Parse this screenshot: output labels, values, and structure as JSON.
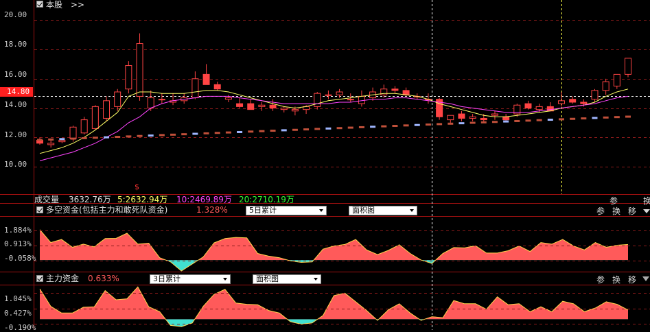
{
  "header": {
    "title": "本股",
    "expand": ">>"
  },
  "price_axis": {
    "labels": [
      "20.00",
      "18.00",
      "16.00",
      "14.80",
      "14.00",
      "12.00",
      "10.00"
    ],
    "current": "14.80"
  },
  "volume": {
    "label": "成交量",
    "total": "3632.76万",
    "ma5": "5:2632.94万",
    "ma10": "10:2469.89万",
    "ma20": "20:2710.19万"
  },
  "panel1": {
    "help": "?",
    "title": "多空资金(包括主力和敢死队资金)",
    "value": "1.328%",
    "period": "5日累计",
    "chart_type": "面积图",
    "levels": [
      "1.884%",
      "0.913%",
      "-0.058%"
    ],
    "tools": [
      "参",
      "换",
      "移"
    ]
  },
  "panel2": {
    "help": "?",
    "title": "主力资金",
    "value": "0.633%",
    "period": "3日累计",
    "chart_type": "面积图",
    "levels": [
      "1.045%",
      "0.427%",
      "-0.190%"
    ],
    "tools": [
      "参",
      "换",
      "移"
    ]
  },
  "right_tools": [
    "参",
    "换"
  ],
  "marker": "$",
  "colors": {
    "up": "#ff4444",
    "down": "#ff4444",
    "ma5": "#ffff66",
    "ma10": "#ff44ff",
    "ma20": "#33ff33",
    "area": "#ff5a5a",
    "area_neg": "#40e0d0",
    "grid": "#8b1a1a",
    "blue": "#9fb6ff"
  },
  "chart_data": [
    {
      "type": "candlestick",
      "title": "本股",
      "ylim": [
        8.5,
        21
      ],
      "candles": [
        [
          11.8,
          12.0,
          11.5,
          11.6
        ],
        [
          11.5,
          11.8,
          11.3,
          11.6
        ],
        [
          11.7,
          11.9,
          11.6,
          11.8
        ],
        [
          11.9,
          12.8,
          11.7,
          12.7
        ],
        [
          12.3,
          13.4,
          12.2,
          13.2
        ],
        [
          12.6,
          14.2,
          12.5,
          14.1
        ],
        [
          13.3,
          14.8,
          13.1,
          14.5
        ],
        [
          14.1,
          15.3,
          13.8,
          15.1
        ],
        [
          15.3,
          17.2,
          15.0,
          16.9
        ],
        [
          14.8,
          19.1,
          14.5,
          18.4
        ],
        [
          14.0,
          15.2,
          13.8,
          14.7
        ],
        [
          14.6,
          15.0,
          14.3,
          14.6
        ],
        [
          14.4,
          15.0,
          14.2,
          14.5
        ],
        [
          14.5,
          15.0,
          14.3,
          14.7
        ],
        [
          14.7,
          16.5,
          14.6,
          16.0
        ],
        [
          16.3,
          17.0,
          16.0,
          15.6
        ],
        [
          15.6,
          15.8,
          15.2,
          15.3
        ],
        [
          14.6,
          14.9,
          14.4,
          14.7
        ],
        [
          14.3,
          14.7,
          14.0,
          14.1
        ],
        [
          14.3,
          14.6,
          13.9,
          13.9
        ],
        [
          14.1,
          14.4,
          13.8,
          14.2
        ],
        [
          14.2,
          14.6,
          13.8,
          14.0
        ],
        [
          13.9,
          14.1,
          13.7,
          14.0
        ],
        [
          13.8,
          14.1,
          13.5,
          13.9
        ],
        [
          13.9,
          14.2,
          13.6,
          14.1
        ],
        [
          14.1,
          15.1,
          13.9,
          15.0
        ],
        [
          14.9,
          15.2,
          14.6,
          14.9
        ],
        [
          14.9,
          15.3,
          14.7,
          15.1
        ],
        [
          14.6,
          15.0,
          14.4,
          14.6
        ],
        [
          14.3,
          15.2,
          14.1,
          14.8
        ],
        [
          14.7,
          15.4,
          14.5,
          15.1
        ],
        [
          14.9,
          15.6,
          14.7,
          15.3
        ],
        [
          15.3,
          15.5,
          15.0,
          15.2
        ],
        [
          15.2,
          15.4,
          14.8,
          14.9
        ],
        [
          14.8,
          15.0,
          14.6,
          14.8
        ],
        [
          14.6,
          15.0,
          14.3,
          14.6
        ],
        [
          14.6,
          14.7,
          13.2,
          13.4
        ],
        [
          13.2,
          13.5,
          13.0,
          13.5
        ],
        [
          13.6,
          13.8,
          13.1,
          13.3
        ],
        [
          13.3,
          13.6,
          13.1,
          13.4
        ],
        [
          13.3,
          13.6,
          13.0,
          13.2
        ],
        [
          13.5,
          13.8,
          13.2,
          13.6
        ],
        [
          13.4,
          13.6,
          13.1,
          13.2
        ],
        [
          13.6,
          14.3,
          13.4,
          14.2
        ],
        [
          14.3,
          14.5,
          13.9,
          14.0
        ],
        [
          13.9,
          14.3,
          13.7,
          14.1
        ],
        [
          14.1,
          14.4,
          13.8,
          13.8
        ],
        [
          14.3,
          15.1,
          14.1,
          14.5
        ],
        [
          14.6,
          14.8,
          14.3,
          14.4
        ],
        [
          14.4,
          14.6,
          14.1,
          14.3
        ],
        [
          14.6,
          15.3,
          14.4,
          15.2
        ],
        [
          15.2,
          16.0,
          14.9,
          15.8
        ],
        [
          15.5,
          16.1,
          15.3,
          16.3
        ],
        [
          16.3,
          17.3,
          16.1,
          17.4
        ]
      ],
      "ma5": [
        10.9,
        11.1,
        11.3,
        11.6,
        12.0,
        12.5,
        13.1,
        13.7,
        14.8,
        15.1,
        15.1,
        15.0,
        15.0,
        15.0,
        15.1,
        15.2,
        15.2,
        15.1,
        14.9,
        14.7,
        14.5,
        14.3,
        14.1,
        14.0,
        14.1,
        14.3,
        14.5,
        14.6,
        14.7,
        14.8,
        14.9,
        15.0,
        15.0,
        14.9,
        14.8,
        14.6,
        14.3,
        14.1,
        13.9,
        13.7,
        13.5,
        13.4,
        13.4,
        13.5,
        13.6,
        13.7,
        13.8,
        14.0,
        14.1,
        14.2,
        14.4,
        14.8,
        15.1,
        15.3
      ],
      "ma10": [
        10.4,
        10.6,
        10.8,
        11.0,
        11.3,
        11.6,
        12.0,
        12.4,
        13.0,
        13.4,
        14.0,
        14.3,
        14.5,
        14.6,
        14.7,
        14.8,
        14.8,
        14.8,
        14.7,
        14.6,
        14.5,
        14.4,
        14.3,
        14.3,
        14.3,
        14.3,
        14.3,
        14.4,
        14.4,
        14.5,
        14.6,
        14.6,
        14.7,
        14.7,
        14.6,
        14.5,
        14.4,
        14.3,
        14.1,
        14.0,
        13.9,
        13.8,
        13.7,
        13.7,
        13.7,
        13.8,
        13.9,
        14.0,
        14.1,
        14.2,
        14.3,
        14.5,
        14.7,
        14.8
      ]
    },
    {
      "type": "area",
      "title": "多空资金(包括主力和敢死队资金)",
      "ylim": [
        -0.7,
        2.6
      ],
      "values": [
        1.95,
        1.12,
        1.32,
        0.82,
        1.02,
        0.85,
        1.38,
        1.39,
        1.72,
        1.02,
        1.08,
        0.15,
        -0.12,
        -0.7,
        -0.25,
        0.2,
        1.1,
        1.38,
        1.45,
        1.42,
        0.42,
        0.25,
        0.15,
        -0.05,
        -0.15,
        -0.12,
        0.7,
        0.9,
        1.0,
        1.32,
        0.65,
        0.35,
        0.62,
        0.98,
        0.42,
        0.0,
        -0.22,
        0.42,
        0.8,
        0.78,
        0.92,
        0.45,
        0.45,
        0.6,
        0.9,
        0.55,
        1.12,
        1.02,
        1.32,
        0.9,
        0.65,
        1.12,
        0.82,
        0.95,
        1.0
      ]
    },
    {
      "type": "area",
      "title": "主力资金",
      "ylim": [
        -0.35,
        1.25
      ],
      "values": [
        1.22,
        0.52,
        0.25,
        0.25,
        0.48,
        0.5,
        1.15,
        0.78,
        0.82,
        1.3,
        0.5,
        0.3,
        -0.25,
        -0.3,
        -0.15,
        0.52,
        1.0,
        1.2,
        0.65,
        0.6,
        0.58,
        0.35,
        0.25,
        -0.1,
        -0.2,
        -0.15,
        0.15,
        0.95,
        1.05,
        0.7,
        0.35,
        -0.05,
        0.38,
        0.62,
        0.25,
        -0.05,
        0.1,
        0.06,
        0.75,
        0.62,
        0.62,
        0.4,
        0.9,
        0.58,
        0.62,
        0.3,
        0.5,
        0.3,
        0.72,
        0.62,
        0.3,
        0.45,
        0.7,
        0.6,
        0.37
      ]
    }
  ]
}
